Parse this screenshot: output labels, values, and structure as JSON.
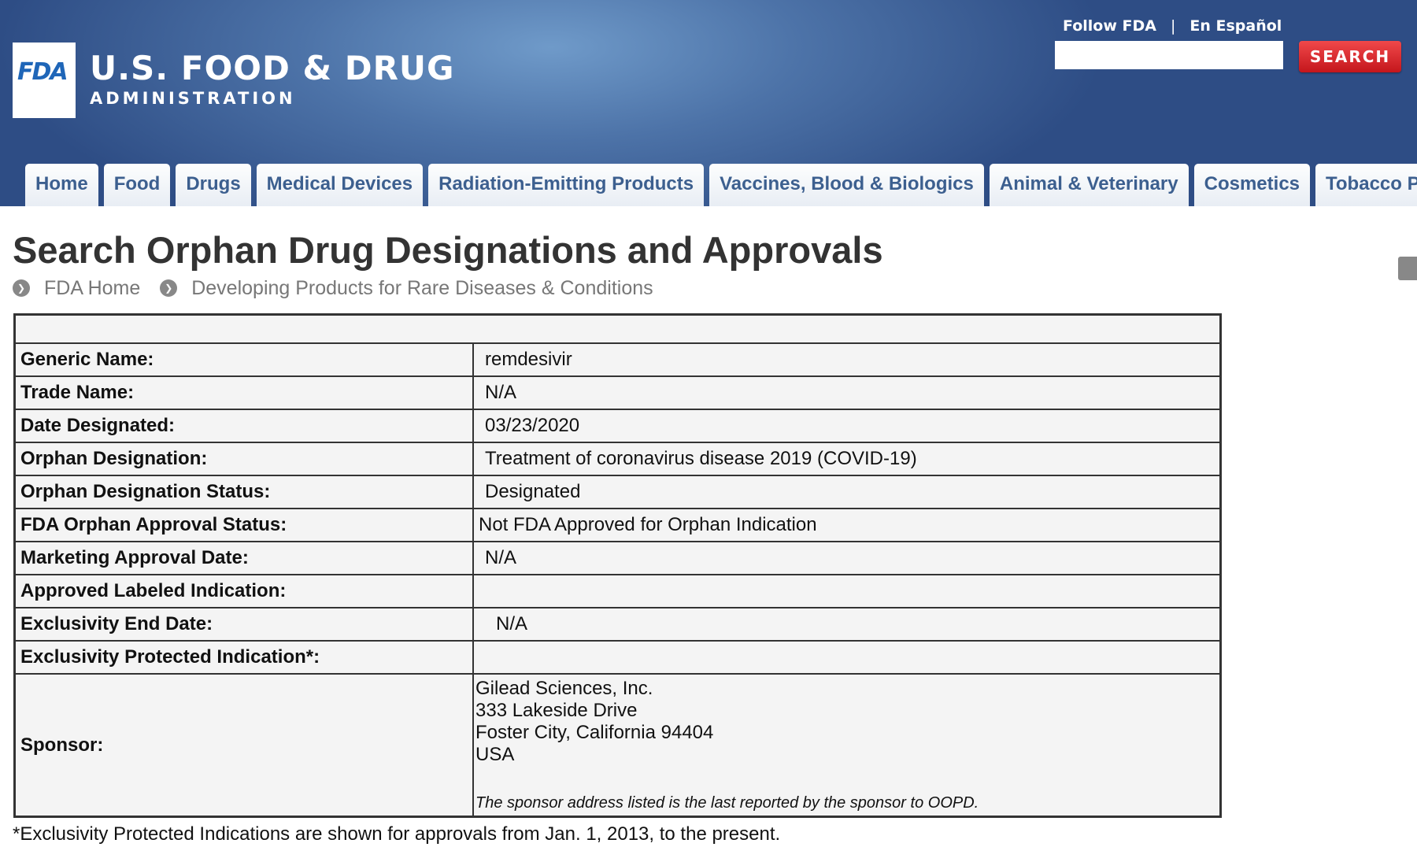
{
  "header": {
    "logo_text": "FDA",
    "agency_line1": "U.S. FOOD & DRUG",
    "agency_line2": "ADMINISTRATION",
    "follow_link": "Follow FDA",
    "separator": "|",
    "spanish_link": "En Español",
    "search_placeholder": "",
    "search_button": "SEARCH"
  },
  "nav": {
    "tabs": [
      "Home",
      "Food",
      "Drugs",
      "Medical Devices",
      "Radiation-Emitting Products",
      "Vaccines, Blood & Biologics",
      "Animal & Veterinary",
      "Cosmetics",
      "Tobacco Products"
    ]
  },
  "page": {
    "title": "Search Orphan Drug Designations and Approvals",
    "breadcrumb": [
      "FDA Home",
      "Developing Products for Rare Diseases & Conditions"
    ]
  },
  "details": {
    "rows": [
      {
        "label": "Generic Name:",
        "value": "remdesivir"
      },
      {
        "label": "Trade Name:",
        "value": "N/A"
      },
      {
        "label": "Date Designated:",
        "value": "03/23/2020"
      },
      {
        "label": "Orphan Designation:",
        "value": "Treatment of coronavirus disease 2019 (COVID-19)"
      },
      {
        "label": "Orphan Designation Status:",
        "value": "Designated"
      },
      {
        "label": "FDA Orphan Approval Status:",
        "value": "Not FDA Approved for Orphan Indication"
      },
      {
        "label": "Marketing Approval Date:",
        "value": "N/A"
      },
      {
        "label": "Approved Labeled Indication:",
        "value": ""
      },
      {
        "label": "Exclusivity End Date:",
        "value": "N/A"
      },
      {
        "label": "Exclusivity Protected Indication*:",
        "value": ""
      }
    ],
    "sponsor": {
      "label": "Sponsor:",
      "lines": [
        "Gilead Sciences, Inc.",
        "333 Lakeside Drive",
        "Foster City, California 94404",
        "USA"
      ],
      "note": "The sponsor address listed is the last reported by the sponsor to OOPD."
    }
  },
  "footnote": "*Exclusivity Protected Indications are shown for approvals from Jan. 1, 2013, to the present.",
  "colors": {
    "header_blue": "#2e4d85",
    "nav_text": "#3c5f8f",
    "search_red": "#c4161c"
  }
}
